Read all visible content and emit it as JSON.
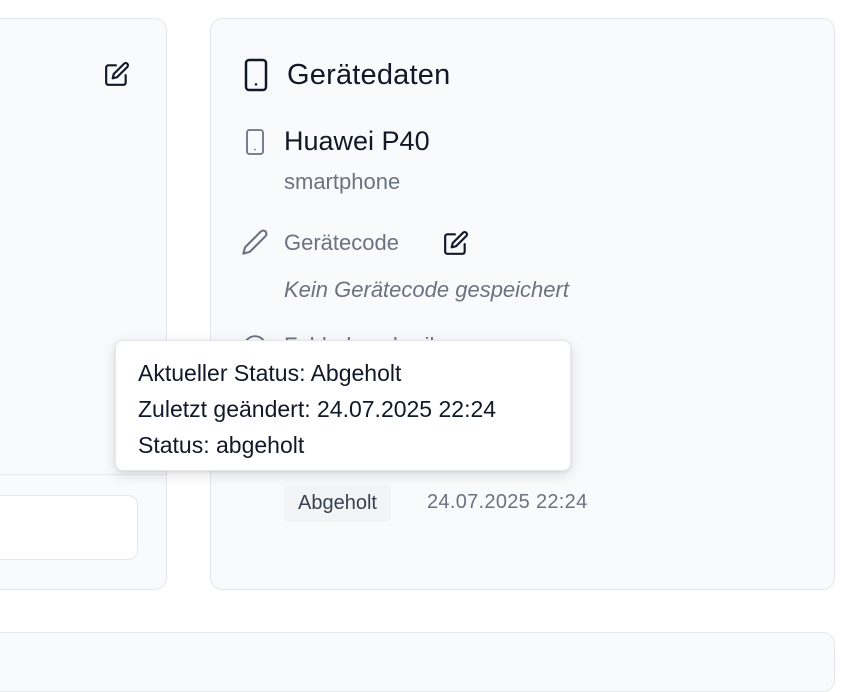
{
  "device_card": {
    "title": "Gerätedaten",
    "device_name": "Huawei P40",
    "device_type": "smartphone",
    "code_label": "Gerätecode",
    "code_empty_text": "Kein Gerätecode gespeichert",
    "hidden_label": "Fehlerbeschreibung",
    "status_badge": "Abgeholt",
    "status_time": "24.07.2025 22:24"
  },
  "tooltip": {
    "line1": "Aktueller Status: Abgeholt",
    "line2": "Zuletzt geändert: 24.07.2025 22:24",
    "line3": "Status: abgeholt"
  },
  "icons": {
    "title_icon": "smartphone-icon",
    "device_icon": "smartphone-icon",
    "code_icon": "pencil-icon",
    "code_edit_icon": "edit-icon",
    "left_edit_icon": "edit-icon"
  },
  "colors": {
    "card_bg": "#f9fafb",
    "border": "#e5e7eb",
    "text_primary": "#111827",
    "text_muted": "#6b7280",
    "badge_bg": "#f3f4f6"
  }
}
